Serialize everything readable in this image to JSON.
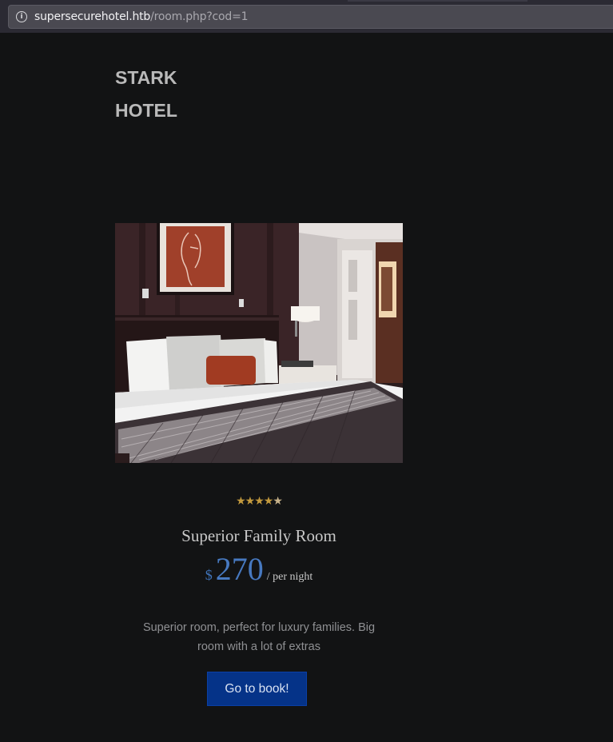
{
  "browser": {
    "url_host": "supersecurehotel.htb",
    "url_path": "/room.php?cod=1",
    "info_icon": "info-icon"
  },
  "site": {
    "logo_line1": "STARK",
    "logo_line2": "HOTEL"
  },
  "room": {
    "photo_icon": "room-photo",
    "rating": 4.5,
    "rating_max": 5,
    "name": "Superior Family Room",
    "currency": "$",
    "price": "270",
    "price_unit": "/ per night",
    "description": "Superior room, perfect for luxury families. Big room with a lot of extras",
    "book_label": "Go to book!"
  },
  "colors": {
    "page_bg": "#121314",
    "accent_blue": "#4779c0",
    "button_bg": "#053388",
    "star": "#c39a3e"
  }
}
